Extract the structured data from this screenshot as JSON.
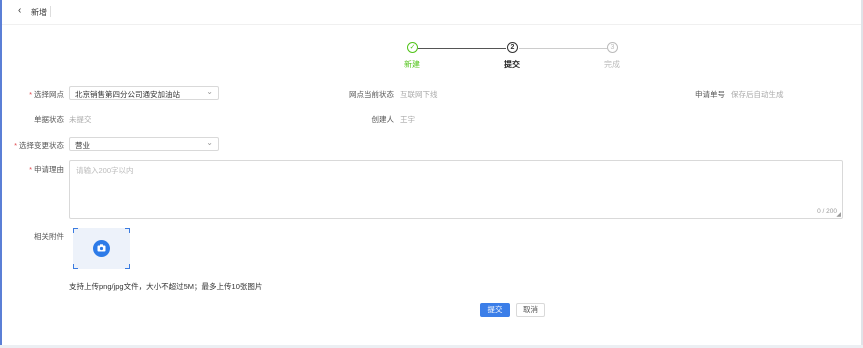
{
  "header": {
    "back_icon": "‹",
    "title": "新增"
  },
  "steps": [
    {
      "label": "新建",
      "marker": "✓",
      "status": "done"
    },
    {
      "label": "提交",
      "marker": "2",
      "status": "active"
    },
    {
      "label": "完成",
      "marker": "3",
      "status": "pending"
    }
  ],
  "form": {
    "site": {
      "label": "选择网点",
      "value": "北京销售第四分公司通安加油站",
      "required": true
    },
    "site_status": {
      "label": "网点当前状态",
      "value": "互联网下线"
    },
    "request_no": {
      "label": "申请单号",
      "value": "保存后自动生成"
    },
    "doc_status": {
      "label": "单据状态",
      "value": "未提交"
    },
    "creator": {
      "label": "创建人",
      "value": "王宇"
    },
    "change_status": {
      "label": "选择变更状态",
      "value": "营业",
      "required": true
    },
    "reason": {
      "label": "申请理由",
      "placeholder": "请输入200字以内",
      "count": "0 / 200",
      "required": true
    },
    "attachment": {
      "label": "相关附件",
      "hint": "支持上传png/jpg文件，大小不超过5M；最多上传10张图片"
    }
  },
  "actions": {
    "submit": "提交",
    "cancel": "取消"
  },
  "colors": {
    "primary": "#3b7ee8",
    "success": "#52c41a",
    "required": "#e0474c"
  }
}
